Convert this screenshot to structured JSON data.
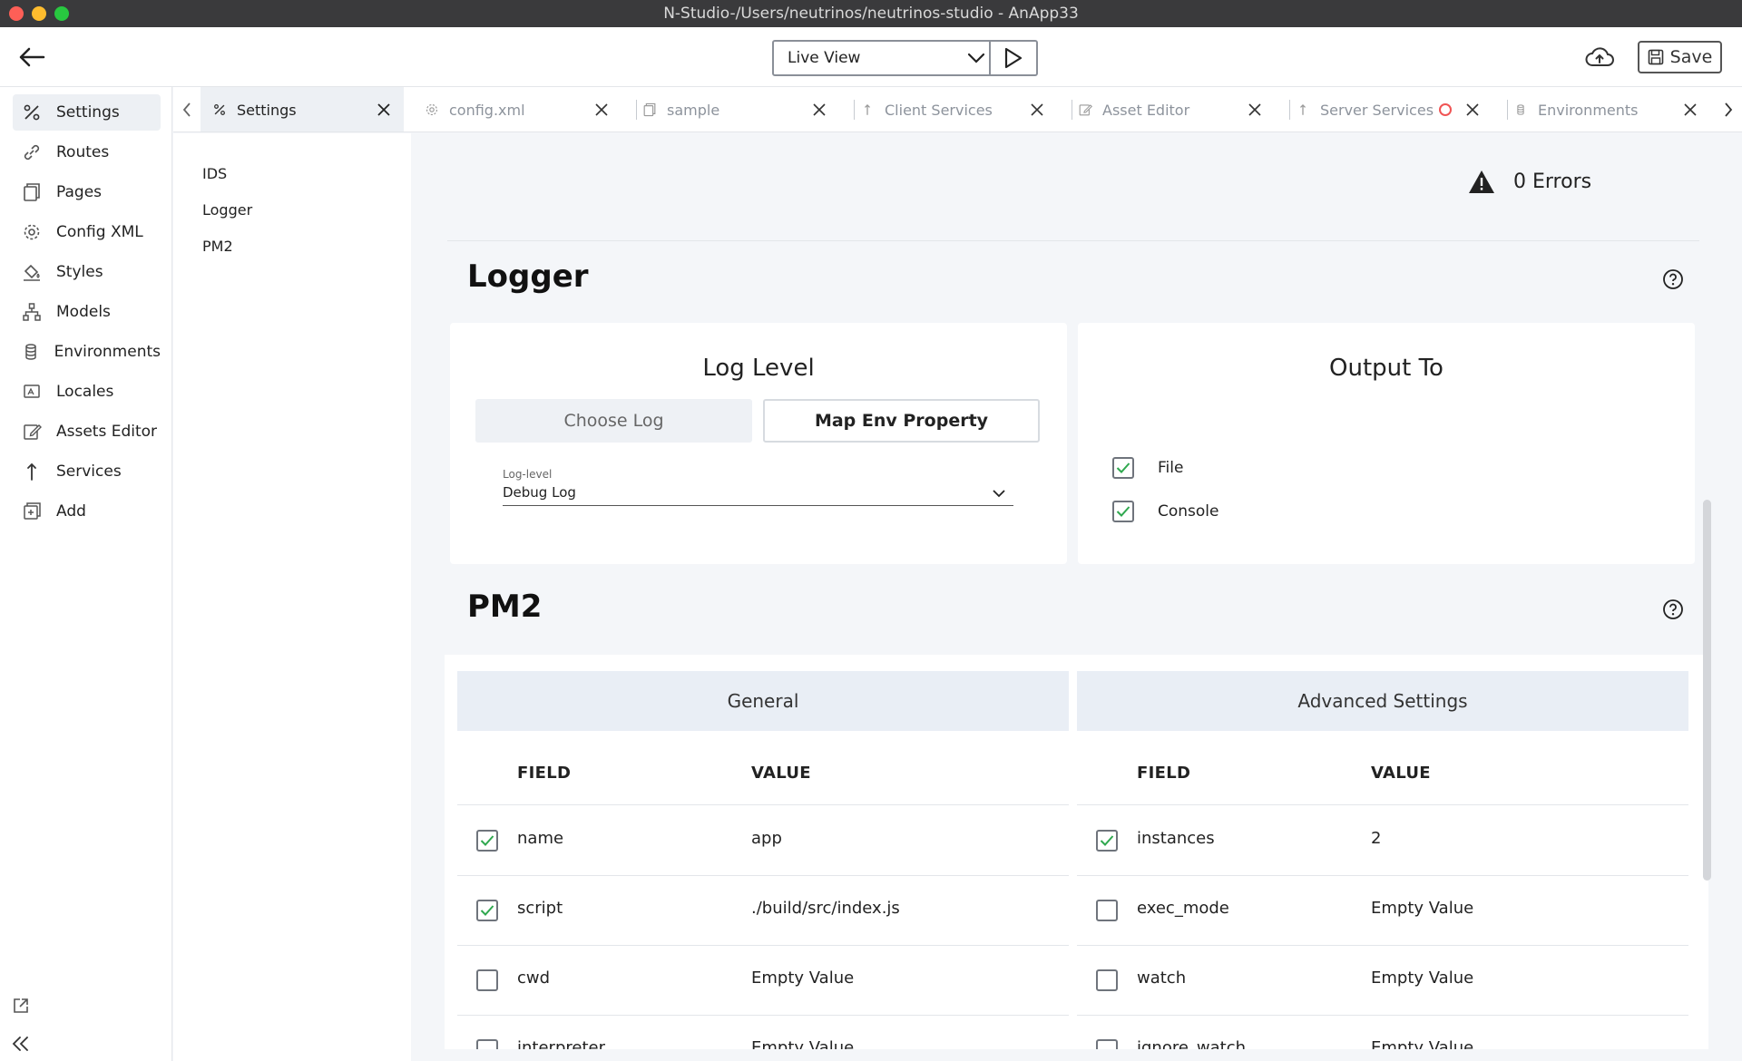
{
  "window": {
    "title": "N-Studio-/Users/neutrinos/neutrinos-studio - AnApp33"
  },
  "toolbar": {
    "view_mode": "Live View",
    "save_label": "Save"
  },
  "nav": {
    "items": [
      {
        "label": "Settings",
        "icon": "settings-icon"
      },
      {
        "label": "Routes",
        "icon": "link-icon"
      },
      {
        "label": "Pages",
        "icon": "pages-icon"
      },
      {
        "label": "Config XML",
        "icon": "gear-icon"
      },
      {
        "label": "Styles",
        "icon": "paint-bucket-icon"
      },
      {
        "label": "Models",
        "icon": "hierarchy-icon"
      },
      {
        "label": "Environments",
        "icon": "database-icon"
      },
      {
        "label": "Locales",
        "icon": "locale-icon"
      },
      {
        "label": "Assets Editor",
        "icon": "edit-icon"
      },
      {
        "label": "Services",
        "icon": "arrow-up-icon"
      },
      {
        "label": "Add",
        "icon": "add-icon"
      }
    ]
  },
  "tabs": [
    {
      "label": "Settings",
      "icon": "settings-icon",
      "active": true
    },
    {
      "label": "config.xml",
      "icon": "gear-icon"
    },
    {
      "label": "sample",
      "icon": "pages-icon"
    },
    {
      "label": "Client Services",
      "icon": "arrow-up-icon"
    },
    {
      "label": "Asset Editor",
      "icon": "edit-icon"
    },
    {
      "label": "Server Services",
      "icon": "arrow-up-icon",
      "unsaved": true
    },
    {
      "label": "Environments",
      "icon": "database-icon"
    }
  ],
  "subnav": {
    "items": [
      "IDS",
      "Logger",
      "PM2"
    ]
  },
  "errors": {
    "label": "0 Errors"
  },
  "logger": {
    "title": "Logger",
    "log_level": {
      "title": "Log Level",
      "choose_label": "Choose Log",
      "map_label": "Map Env Property",
      "field_label": "Log-level",
      "field_value": "Debug Log"
    },
    "output": {
      "title": "Output To",
      "options": [
        {
          "label": "File",
          "checked": true
        },
        {
          "label": "Console",
          "checked": true
        }
      ]
    }
  },
  "pm2": {
    "title": "PM2",
    "columns": {
      "field": "FIELD",
      "value": "VALUE"
    },
    "general": {
      "title": "General",
      "rows": [
        {
          "field": "name",
          "value": "app",
          "checked": true
        },
        {
          "field": "script",
          "value": "./build/src/index.js",
          "checked": true
        },
        {
          "field": "cwd",
          "value": "Empty Value",
          "checked": false
        },
        {
          "field": "interpreter",
          "value": "Empty Value",
          "checked": false
        }
      ]
    },
    "advanced": {
      "title": "Advanced Settings",
      "rows": [
        {
          "field": "instances",
          "value": "2",
          "checked": true
        },
        {
          "field": "exec_mode",
          "value": "Empty Value",
          "checked": false
        },
        {
          "field": "watch",
          "value": "Empty Value",
          "checked": false
        },
        {
          "field": "ignore_watch",
          "value": "Empty Value",
          "checked": false
        }
      ]
    }
  },
  "colors": {
    "check": "#2fa84f",
    "accent_red": "#f05454",
    "active_bg": "#edf0f4"
  }
}
